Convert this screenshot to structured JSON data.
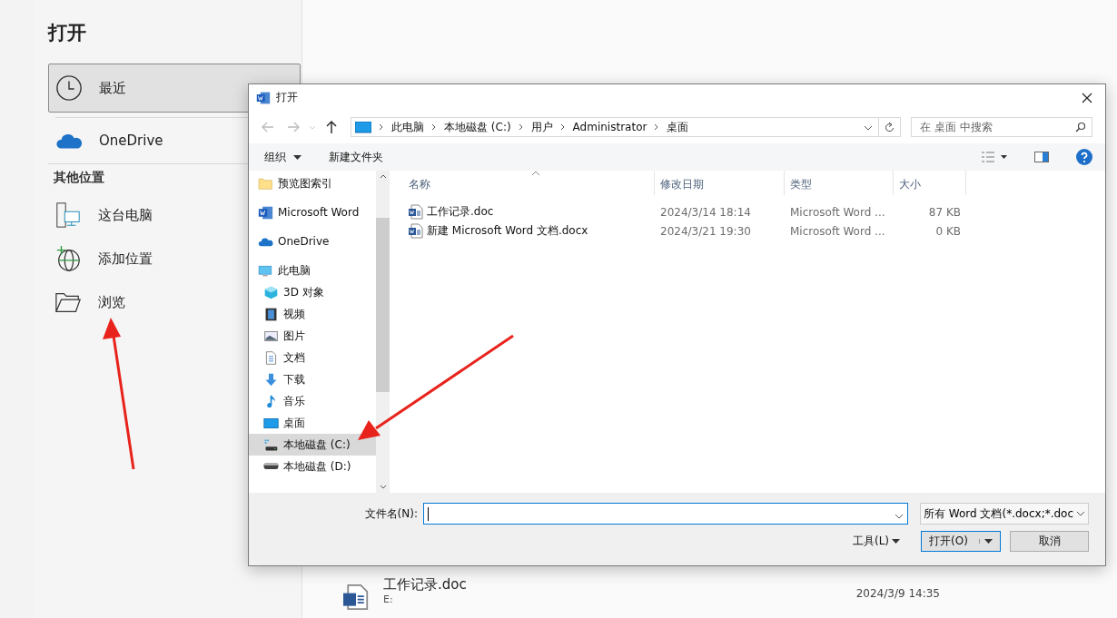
{
  "backstage": {
    "title": "打开",
    "nav": [
      {
        "label": "最近",
        "kind": "clock",
        "selected": true
      },
      {
        "label": "OneDrive",
        "kind": "cloud",
        "selected": false
      }
    ],
    "section_heading": "其他位置",
    "places": [
      {
        "label": "这台电脑",
        "kind": "pc"
      },
      {
        "label": "添加位置",
        "kind": "globe"
      },
      {
        "label": "浏览",
        "kind": "folder"
      }
    ],
    "recent_file": {
      "name": "工作记录.doc",
      "path": "E:",
      "date": "2024/3/9 14:35"
    }
  },
  "dialog": {
    "title": "打开",
    "breadcrumb": [
      "此电脑",
      "本地磁盘 (C:)",
      "用户",
      "Administrator",
      "桌面"
    ],
    "search": {
      "placeholder": "在 桌面 中搜索"
    },
    "toolbar": {
      "organize": "组织",
      "new_folder": "新建文件夹"
    },
    "nav_tree": [
      {
        "label": "预览图索引",
        "kind": "folder",
        "selected": false
      },
      {
        "label": "Microsoft Word",
        "kind": "word",
        "selected": false
      },
      {
        "label": "OneDrive",
        "kind": "cloud",
        "selected": false
      },
      {
        "label": "此电脑",
        "kind": "pc",
        "selected": false,
        "children": [
          {
            "label": "3D 对象",
            "kind": "cube",
            "selected": false
          },
          {
            "label": "视频",
            "kind": "video",
            "selected": false
          },
          {
            "label": "图片",
            "kind": "picture",
            "selected": false
          },
          {
            "label": "文档",
            "kind": "document",
            "selected": false
          },
          {
            "label": "下载",
            "kind": "download",
            "selected": false
          },
          {
            "label": "音乐",
            "kind": "music",
            "selected": false
          },
          {
            "label": "桌面",
            "kind": "desktop",
            "selected": false
          },
          {
            "label": "本地磁盘 (C:)",
            "kind": "drive_c",
            "selected": true
          },
          {
            "label": "本地磁盘 (D:)",
            "kind": "drive",
            "selected": false
          }
        ]
      }
    ],
    "columns": [
      "名称",
      "修改日期",
      "类型",
      "大小"
    ],
    "files": [
      {
        "name": "工作记录.doc",
        "modified": "2024/3/14 18:14",
        "type": "Microsoft Word ...",
        "size": "87 KB"
      },
      {
        "name": "新建 Microsoft Word 文档.docx",
        "modified": "2024/3/21 19:30",
        "type": "Microsoft Word ...",
        "size": "0 KB"
      }
    ],
    "filename_label": "文件名(N):",
    "filter": "所有 Word 文档(*.docx;*.doc",
    "buttons": [
      {
        "label": "工具(L)",
        "kind": "menu"
      },
      {
        "label": "打开(O)",
        "kind": "split"
      },
      {
        "label": "取消",
        "kind": "plain"
      }
    ]
  }
}
